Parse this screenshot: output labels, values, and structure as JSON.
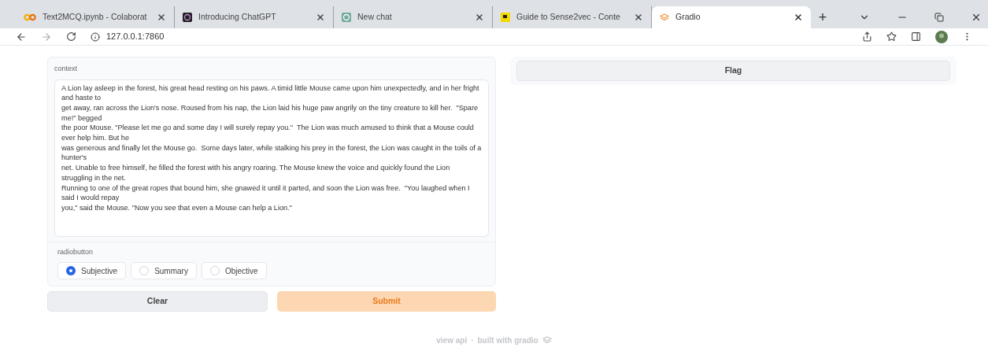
{
  "browser": {
    "tabs": [
      {
        "title": "Text2MCQ.ipynb - Colaborat",
        "kind": "colab",
        "selected": false
      },
      {
        "title": "Introducing ChatGPT",
        "kind": "chatgpt",
        "selected": false
      },
      {
        "title": "New chat",
        "kind": "newchat",
        "selected": false
      },
      {
        "title": "Guide to Sense2vec - Conte",
        "kind": "guide",
        "selected": false
      },
      {
        "title": "Gradio",
        "kind": "gradio",
        "selected": true
      }
    ],
    "new_tab": "+",
    "address": "127.0.0.1:7860"
  },
  "context": {
    "label": "context",
    "value": "A Lion lay asleep in the forest, his great head resting on his paws. A timid little Mouse came upon him unexpectedly, and in her fright and haste to\nget away, ran across the Lion's nose. Roused from his nap, the Lion laid his huge paw angrily on the tiny creature to kill her.  \"Spare me!\" begged\nthe poor Mouse. \"Please let me go and some day I will surely repay you.\"  The Lion was much amused to think that a Mouse could ever help him. But he\nwas generous and finally let the Mouse go.  Some days later, while stalking his prey in the forest, the Lion was caught in the toils of a hunter's\nnet. Unable to free himself, he filled the forest with his angry roaring. The Mouse knew the voice and quickly found the Lion struggling in the net.\nRunning to one of the great ropes that bound him, she gnawed it until it parted, and soon the Lion was free.  \"You laughed when I said I would repay\nyou,\" said the Mouse. \"Now you see that even a Mouse can help a Lion.\""
  },
  "radio": {
    "label": "radiobutton",
    "options": [
      {
        "label": "Subjective",
        "selected": true
      },
      {
        "label": "Summary",
        "selected": false
      },
      {
        "label": "Objective",
        "selected": false
      }
    ]
  },
  "buttons": [
    {
      "label": "Clear",
      "kind": "secondary"
    },
    {
      "label": "Submit",
      "kind": "primary"
    }
  ],
  "flag_button": "Flag",
  "footer": {
    "api_link": "view api",
    "separator": "·",
    "built_with": "built with gradio"
  }
}
